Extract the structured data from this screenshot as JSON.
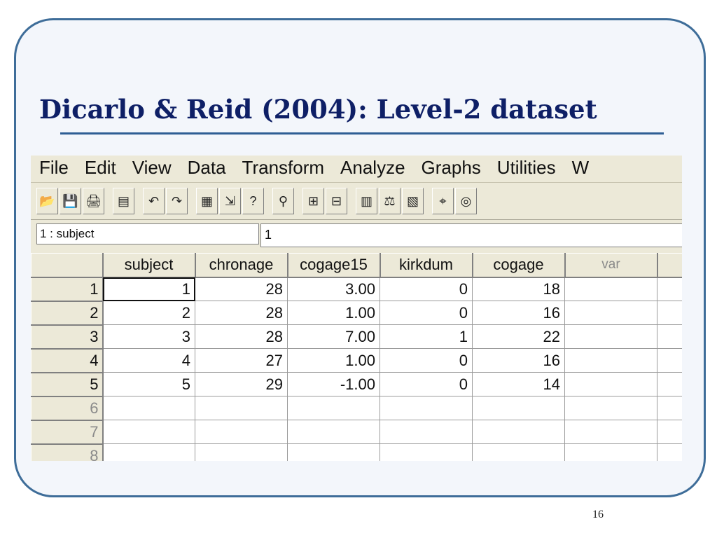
{
  "slide": {
    "title": "Dicarlo & Reid (2004): Level-2 dataset",
    "page_number": "16"
  },
  "menubar": {
    "items": [
      "File",
      "Edit",
      "View",
      "Data",
      "Transform",
      "Analyze",
      "Graphs",
      "Utilities",
      "W"
    ]
  },
  "toolbar": {
    "buttons": [
      {
        "icon": "open-folder-icon",
        "glyph": "📂"
      },
      {
        "icon": "save-icon",
        "glyph": "💾"
      },
      {
        "icon": "print-icon",
        "glyph": "🖨"
      },
      {
        "icon": "dialog-recall-icon",
        "glyph": "▤"
      },
      {
        "icon": "undo-icon",
        "glyph": "↶"
      },
      {
        "icon": "redo-icon",
        "glyph": "↷"
      },
      {
        "icon": "goto-chart-icon",
        "glyph": "▦"
      },
      {
        "icon": "goto-case-icon",
        "glyph": "⇲"
      },
      {
        "icon": "variables-icon",
        "glyph": "?"
      },
      {
        "icon": "find-icon",
        "glyph": "⚲"
      },
      {
        "icon": "insert-cases-icon",
        "glyph": "⊞"
      },
      {
        "icon": "insert-variable-icon",
        "glyph": "⊟"
      },
      {
        "icon": "split-file-icon",
        "glyph": "▥"
      },
      {
        "icon": "weight-cases-icon",
        "glyph": "⚖"
      },
      {
        "icon": "select-cases-icon",
        "glyph": "▧"
      },
      {
        "icon": "value-labels-icon",
        "glyph": "⌖"
      },
      {
        "icon": "use-sets-icon",
        "glyph": "◎"
      }
    ]
  },
  "cell_editor": {
    "reference": "1 : subject",
    "value": "1"
  },
  "grid": {
    "columns": [
      "subject",
      "chronage",
      "cogage15",
      "kirkdum",
      "cogage",
      "var"
    ],
    "rows": [
      {
        "num": "1",
        "cells": [
          "1",
          "28",
          "3.00",
          "0",
          "18",
          ""
        ]
      },
      {
        "num": "2",
        "cells": [
          "2",
          "28",
          "1.00",
          "0",
          "16",
          ""
        ]
      },
      {
        "num": "3",
        "cells": [
          "3",
          "28",
          "7.00",
          "1",
          "22",
          ""
        ]
      },
      {
        "num": "4",
        "cells": [
          "4",
          "27",
          "1.00",
          "0",
          "16",
          ""
        ]
      },
      {
        "num": "5",
        "cells": [
          "5",
          "29",
          "-1.00",
          "0",
          "14",
          ""
        ]
      },
      {
        "num": "6",
        "cells": [
          "",
          "",
          "",
          "",
          "",
          ""
        ]
      },
      {
        "num": "7",
        "cells": [
          "",
          "",
          "",
          "",
          "",
          ""
        ]
      },
      {
        "num": "8",
        "cells": [
          "",
          "",
          "",
          "",
          "",
          ""
        ]
      }
    ]
  },
  "colors": {
    "frame": "#3e6d99",
    "title": "#0e1f66",
    "window_face": "#ece9d8"
  }
}
